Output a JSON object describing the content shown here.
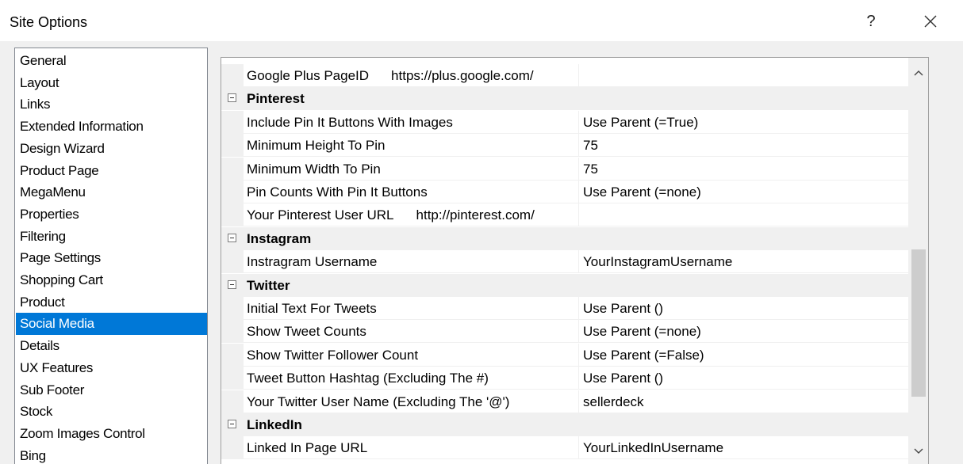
{
  "window": {
    "title": "Site Options",
    "help_label": "?"
  },
  "categories": [
    {
      "label": "General"
    },
    {
      "label": "Layout"
    },
    {
      "label": "Links"
    },
    {
      "label": "Extended Information"
    },
    {
      "label": "Design Wizard"
    },
    {
      "label": "Product Page"
    },
    {
      "label": "MegaMenu"
    },
    {
      "label": "Properties"
    },
    {
      "label": "Filtering"
    },
    {
      "label": "Page Settings"
    },
    {
      "label": "Shopping Cart"
    },
    {
      "label": "Product"
    },
    {
      "label": "Social Media",
      "selected": true
    },
    {
      "label": "Details"
    },
    {
      "label": "UX Features"
    },
    {
      "label": "Sub Footer"
    },
    {
      "label": "Stock"
    },
    {
      "label": "Zoom Images Control"
    },
    {
      "label": "Bing"
    }
  ],
  "grid": {
    "rows": [
      {
        "kind": "prop",
        "name": "Google Plus PageID",
        "hint": "https://plus.google.com/",
        "value": ""
      },
      {
        "kind": "category",
        "name": "Pinterest"
      },
      {
        "kind": "prop",
        "name": "Include Pin It Buttons With Images",
        "value": "Use Parent (=True)"
      },
      {
        "kind": "prop",
        "name": "Minimum Height To Pin",
        "value": "75"
      },
      {
        "kind": "prop",
        "name": "Minimum Width To Pin",
        "value": "75"
      },
      {
        "kind": "prop",
        "name": "Pin Counts With Pin It Buttons",
        "value": "Use Parent (=none)"
      },
      {
        "kind": "prop",
        "name": "Your Pinterest User URL",
        "hint": "http://pinterest.com/",
        "value": ""
      },
      {
        "kind": "category",
        "name": "Instagram"
      },
      {
        "kind": "prop",
        "name": "Instragram Username",
        "value": "YourInstagramUsername"
      },
      {
        "kind": "category",
        "name": "Twitter"
      },
      {
        "kind": "prop",
        "name": "Initial Text For Tweets",
        "value": "Use Parent ()"
      },
      {
        "kind": "prop",
        "name": "Show Tweet Counts",
        "value": "Use Parent (=none)"
      },
      {
        "kind": "prop",
        "name": "Show Twitter Follower Count",
        "value": "Use Parent (=False)"
      },
      {
        "kind": "prop",
        "name": "Tweet Button Hashtag (Excluding The #)",
        "value": "Use Parent ()"
      },
      {
        "kind": "prop",
        "name": "Your Twitter User Name (Excluding The '@')",
        "value": "sellerdeck"
      },
      {
        "kind": "category",
        "name": "LinkedIn"
      },
      {
        "kind": "prop",
        "name": "Linked In Page URL",
        "value": "YourLinkedInUsername"
      }
    ]
  },
  "icons": {
    "close": "close-icon",
    "collapse": "minus-box-icon",
    "scroll_up": "chevron-up-icon",
    "scroll_down": "chevron-down-icon"
  },
  "colors": {
    "selection": "#0078d7",
    "category_band": "#f0f0f0"
  }
}
